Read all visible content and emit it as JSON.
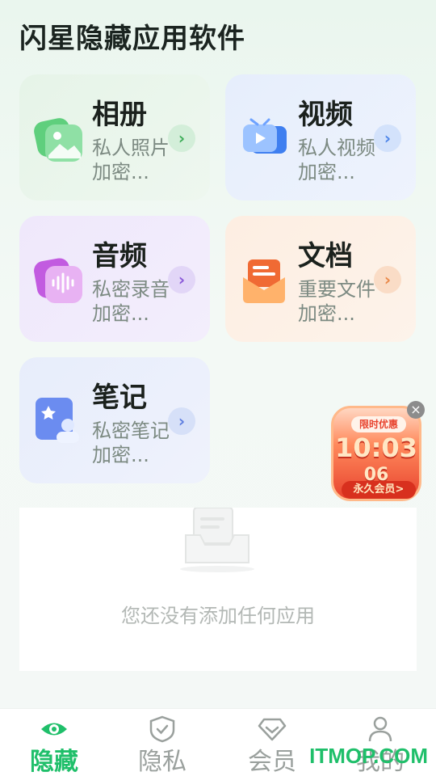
{
  "page": {
    "title": "闪星隐藏应用软件"
  },
  "cards": [
    {
      "title": "相册",
      "subtitle": "私人照片加密..."
    },
    {
      "title": "视频",
      "subtitle": "私人视频加密..."
    },
    {
      "title": "音频",
      "subtitle": "私密录音加密..."
    },
    {
      "title": "文档",
      "subtitle": "重要文件加密..."
    },
    {
      "title": "笔记",
      "subtitle": "私密笔记加密..."
    }
  ],
  "empty": {
    "text": "您还没有添加任何应用"
  },
  "promo": {
    "tag": "限时优惠",
    "time": "10:03",
    "sub": "06",
    "button": "永久会员>"
  },
  "tabs": [
    {
      "label": "隐藏",
      "icon": "eye-icon",
      "active": true
    },
    {
      "label": "隐私",
      "icon": "shield-check-icon"
    },
    {
      "label": "会员",
      "icon": "diamond-icon"
    },
    {
      "label": "我的",
      "icon": "user-icon"
    }
  ],
  "watermark": "ITMOP.COM",
  "colors": {
    "accent": "#1fbf6a"
  }
}
